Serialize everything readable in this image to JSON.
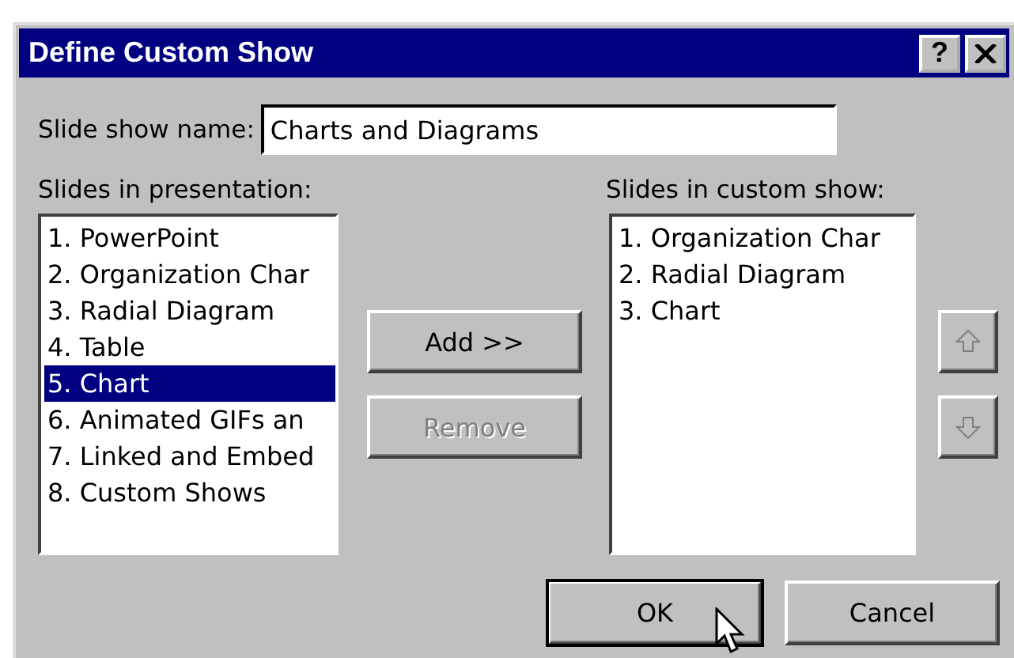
{
  "window": {
    "title": "Define Custom Show",
    "help": "?"
  },
  "name_field": {
    "label": "Slide show name:",
    "value": "Charts and Diagrams"
  },
  "presentation_list": {
    "label": "Slides in presentation:",
    "items": [
      {
        "text": "1. PowerPoint",
        "selected": false
      },
      {
        "text": "2. Organization Char",
        "selected": false
      },
      {
        "text": "3. Radial Diagram",
        "selected": false
      },
      {
        "text": "4. Table",
        "selected": false
      },
      {
        "text": "5. Chart",
        "selected": true
      },
      {
        "text": "6. Animated GIFs an",
        "selected": false
      },
      {
        "text": "7. Linked and Embed",
        "selected": false
      },
      {
        "text": "8. Custom Shows",
        "selected": false
      }
    ]
  },
  "move_buttons": [
    {
      "label": "Add >>",
      "disabled": false
    },
    {
      "label": "Remove",
      "disabled": true
    }
  ],
  "custom_show_list": {
    "label": "Slides in custom show:",
    "items": [
      {
        "text": "1. Organization Char",
        "selected": false
      },
      {
        "text": "2. Radial Diagram",
        "selected": false
      },
      {
        "text": "3. Chart",
        "selected": false
      }
    ]
  },
  "order_buttons": [
    {
      "kind": "up",
      "disabled": true
    },
    {
      "kind": "down",
      "disabled": true
    }
  ],
  "dialog_buttons": [
    {
      "label": "OK",
      "default": true
    },
    {
      "label": "Cancel",
      "default": false
    }
  ]
}
